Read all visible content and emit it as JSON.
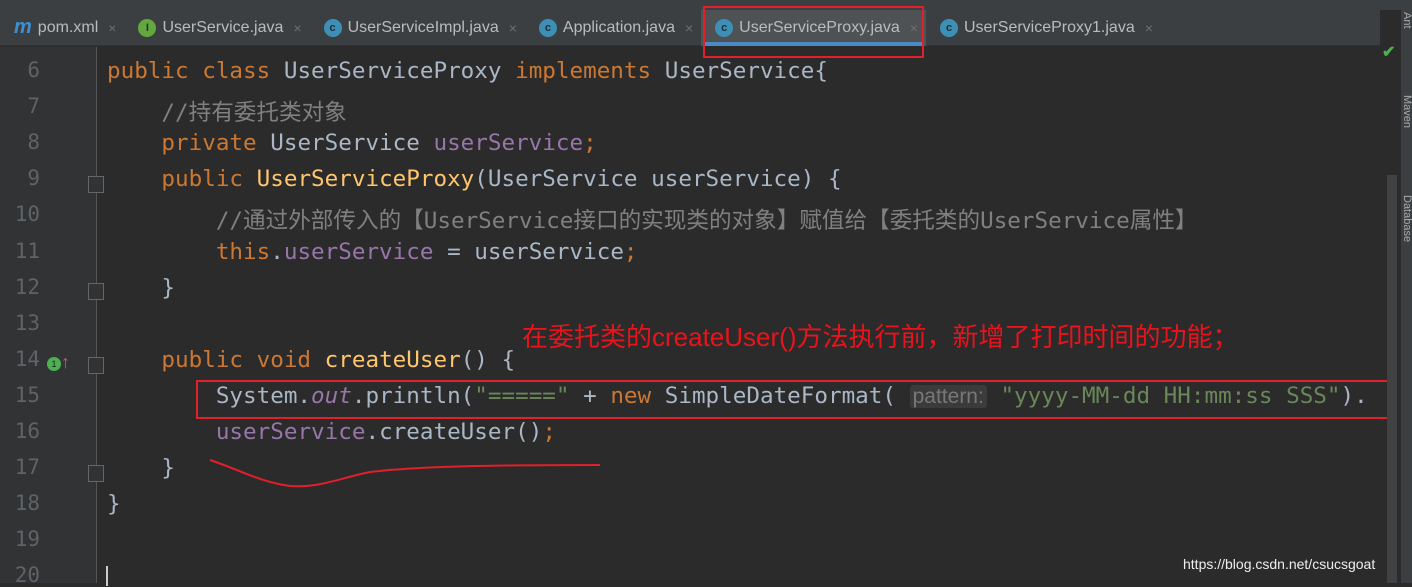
{
  "tabs": [
    {
      "label": "pom.xml",
      "icon": "maven-icon",
      "glyph": "m"
    },
    {
      "label": "UserService.java",
      "icon": "interface-icon",
      "glyph": "I",
      "color": "#62a83c"
    },
    {
      "label": "UserServiceImpl.java",
      "icon": "class-icon",
      "glyph": "c",
      "color": "#3e8fb6"
    },
    {
      "label": "Application.java",
      "icon": "runnable-class-icon",
      "glyph": "c",
      "color": "#3e8fb6"
    },
    {
      "label": "UserServiceProxy.java",
      "icon": "class-icon",
      "glyph": "c",
      "color": "#3e8fb6",
      "active": true
    },
    {
      "label": "UserServiceProxy1.java",
      "icon": "class-icon",
      "glyph": "c",
      "color": "#3e8fb6"
    }
  ],
  "close_glyph": "×",
  "line_numbers": [
    "6",
    "7",
    "8",
    "9",
    "10",
    "11",
    "12",
    "13",
    "14",
    "15",
    "16",
    "17",
    "18",
    "19",
    "20"
  ],
  "code_lines": [
    [
      [
        "public class ",
        "kw"
      ],
      [
        "UserServiceProxy ",
        ""
      ],
      [
        "implements ",
        "kw"
      ],
      [
        "UserService{",
        ""
      ]
    ],
    [
      [
        "    //持有委托类对象",
        "cm"
      ]
    ],
    [
      [
        "    private ",
        "kw"
      ],
      [
        "UserService ",
        ""
      ],
      [
        "userService",
        "fld"
      ],
      [
        ";",
        "kw"
      ]
    ],
    [
      [
        "    public ",
        "kw"
      ],
      [
        "UserServiceProxy",
        "fn"
      ],
      [
        "(UserService userService) {",
        ""
      ]
    ],
    [
      [
        "        //通过外部传入的【UserService接口的实现类的对象】赋值给【委托类的UserService属性】",
        "cm"
      ]
    ],
    [
      [
        "        this",
        "kw"
      ],
      [
        ".",
        ""
      ],
      [
        "userService",
        "fld"
      ],
      [
        " = userService",
        ""
      ],
      [
        ";",
        "kw"
      ]
    ],
    [
      [
        "    }",
        ""
      ]
    ],
    [
      [
        "",
        ""
      ]
    ],
    [
      [
        "    public void ",
        "kw"
      ],
      [
        "createUser",
        "fn"
      ],
      [
        "() {",
        ""
      ]
    ],
    [
      [
        "        System.",
        ""
      ],
      [
        "out",
        "it"
      ],
      [
        ".println(",
        ""
      ],
      [
        "\"=====\"",
        "st"
      ],
      [
        " + ",
        ""
      ],
      [
        "new ",
        "kw"
      ],
      [
        "SimpleDateFormat( ",
        ""
      ],
      [
        "pattern:",
        "hint"
      ],
      [
        " ",
        ""
      ],
      [
        "\"yyyy-MM-dd HH:mm:ss SSS\"",
        "st"
      ],
      [
        ").",
        ""
      ]
    ],
    [
      [
        "        ",
        ""
      ],
      [
        "userService",
        "fld"
      ],
      [
        ".createUser()",
        ""
      ],
      [
        ";",
        "kw"
      ]
    ],
    [
      [
        "    }",
        ""
      ]
    ],
    [
      [
        "}",
        ""
      ]
    ],
    [
      [
        "",
        ""
      ]
    ],
    [
      [
        "",
        ""
      ]
    ]
  ],
  "annotation": "在委托类的createUser()方法执行前，新增了打印时间的功能；",
  "side_tools": [
    "Ant",
    "Maven",
    "Database"
  ],
  "watermark": "https://blog.csdn.net/csucsgoat",
  "colors": {
    "annotation": "#e8141c",
    "accent": "#4a88c7"
  }
}
